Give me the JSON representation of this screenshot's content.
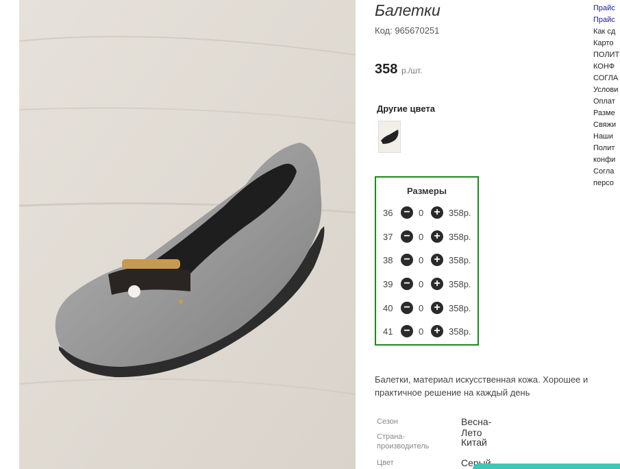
{
  "product": {
    "title": "Балетки",
    "code": "Код: 965670251",
    "price": "358",
    "price_unit": "р./шт.",
    "other_colors_label": "Другие цвета",
    "description": "Балетки, материал искусственная кожа. Хорошее и практичное решение на каждый день"
  },
  "sizes": {
    "header": "Размеры",
    "rows": [
      {
        "size": "36",
        "qty": "0",
        "price": "358р."
      },
      {
        "size": "37",
        "qty": "0",
        "price": "358р."
      },
      {
        "size": "38",
        "qty": "0",
        "price": "358р."
      },
      {
        "size": "39",
        "qty": "0",
        "price": "358р."
      },
      {
        "size": "40",
        "qty": "0",
        "price": "358р."
      },
      {
        "size": "41",
        "qty": "0",
        "price": "358р."
      }
    ]
  },
  "properties": [
    {
      "label": "Сезон",
      "value": "Весна-Лето"
    },
    {
      "label": "Страна-производитель",
      "value": "Китай"
    },
    {
      "label": "Цвет",
      "value": "Серый"
    }
  ],
  "side_links": [
    "Прайс",
    "Прайс",
    "Как сд",
    "Карто",
    "ПОЛИТ",
    "КОНФ",
    "СОГЛА",
    "Услови",
    "Оплат",
    "Разме",
    "Свяжи",
    "Наши",
    "Полит",
    "конфи",
    "Согла",
    "персо"
  ],
  "colors": {
    "accent_border": "#1a8a1a",
    "link": "#1a1a99",
    "bar": "#3ec7b6"
  },
  "icons": {
    "minus": "minus-circle-icon",
    "plus": "plus-circle-icon"
  }
}
